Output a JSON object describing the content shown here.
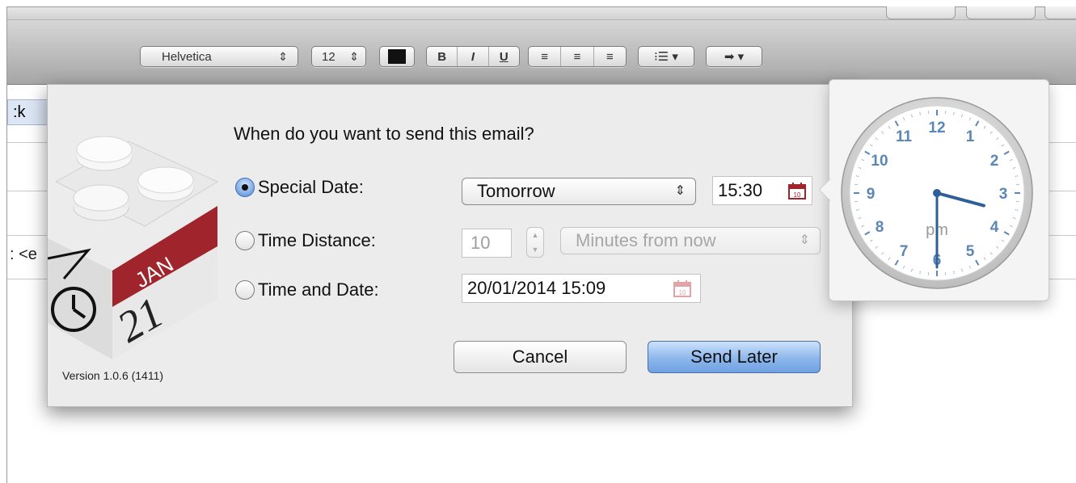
{
  "toolbar": {
    "font_name": "Helvetica",
    "font_size": "12",
    "bold": "B",
    "italic": "I",
    "underline": "U",
    "color_swatch": "#111111"
  },
  "background": {
    "tab_text": ":k",
    "fragment_text": ": <e"
  },
  "dialog": {
    "question": "When do you want to send this email?",
    "version": "Version 1.0.6 (1411)",
    "icon": {
      "month": "JAN",
      "day": "21",
      "name": "calendar-lego-icon"
    },
    "special_date": {
      "label": "Special Date:",
      "selected": true,
      "popup_value": "Tomorrow",
      "time": "15:30"
    },
    "time_distance": {
      "label": "Time Distance:",
      "selected": false,
      "amount": "10",
      "unit": "Minutes from now"
    },
    "time_and_date": {
      "label": "Time and Date:",
      "selected": false,
      "value": "20/01/2014 15:09"
    },
    "cancel_label": "Cancel",
    "send_later_label": "Send Later"
  },
  "clock": {
    "ampm": "pm",
    "hour": 15,
    "minute": 30,
    "numbers": [
      "12",
      "1",
      "2",
      "3",
      "4",
      "5",
      "6",
      "7",
      "8",
      "9",
      "10",
      "11"
    ],
    "face_color": "#5b86b8"
  },
  "colors": {
    "accent_blue": "#6fa1e2",
    "calendar_red": "#a0242b"
  }
}
